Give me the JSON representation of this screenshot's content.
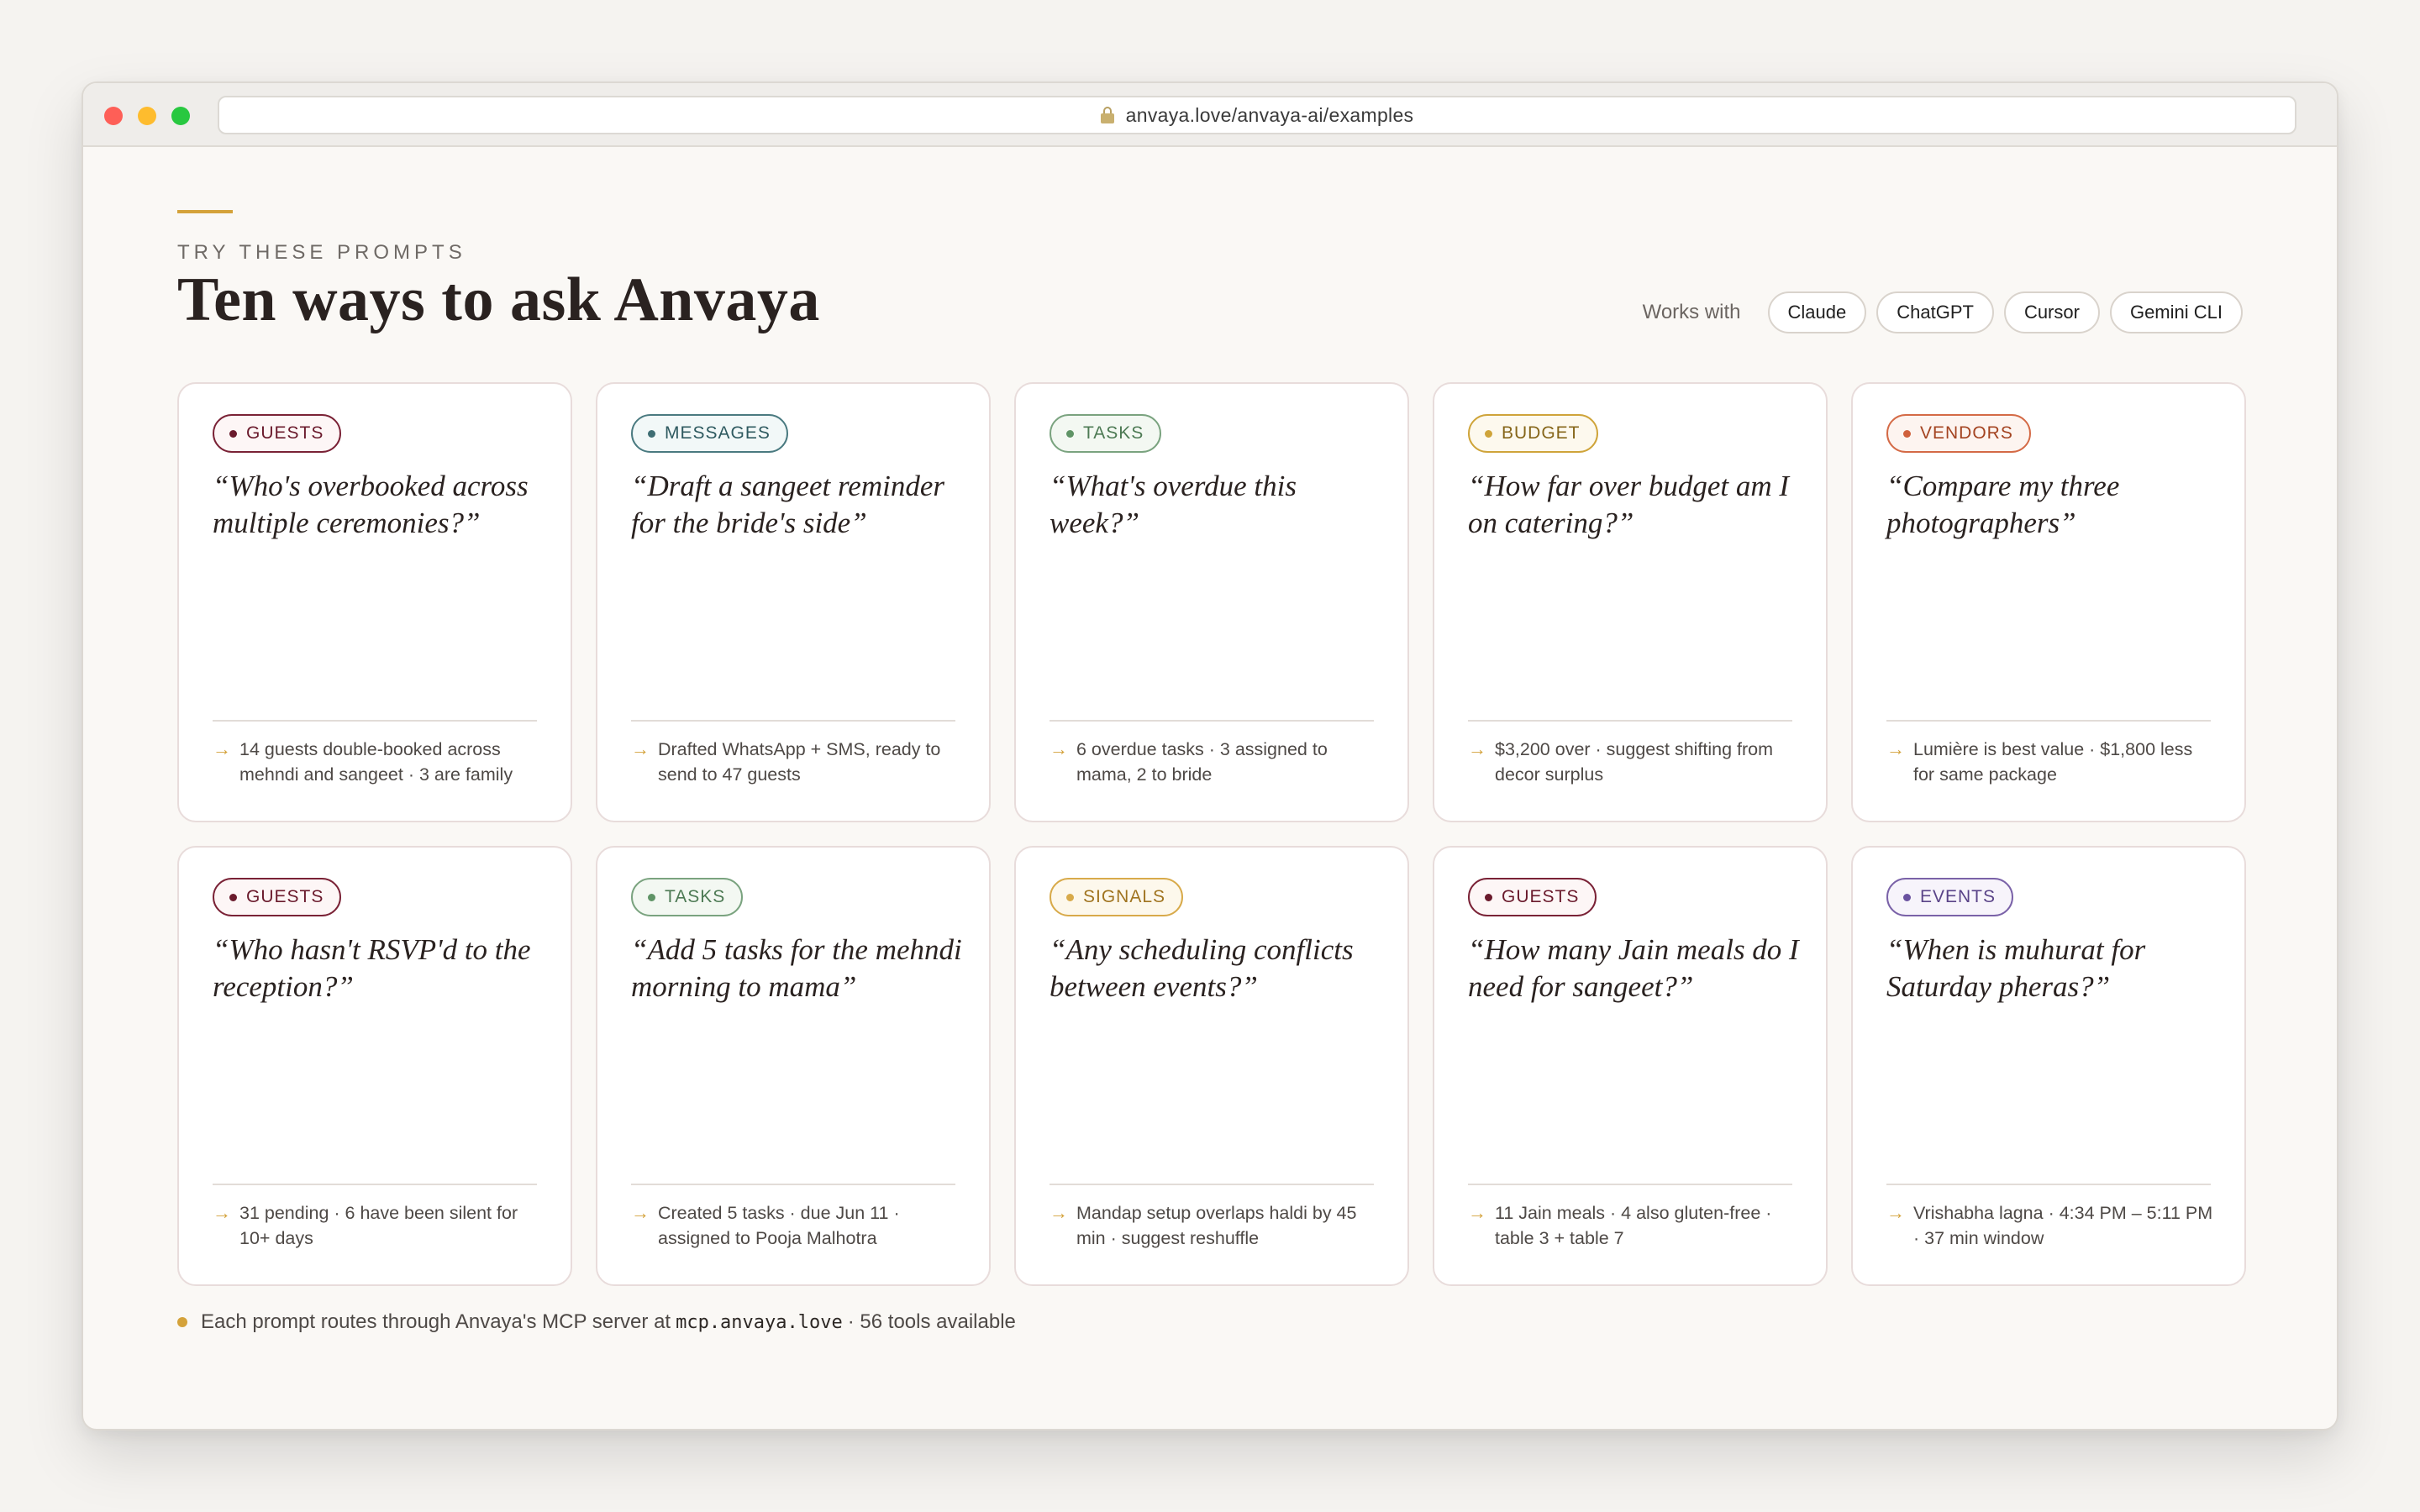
{
  "browser": {
    "url": "anvaya.love/anvaya-ai/examples"
  },
  "header": {
    "eyebrow": "TRY THESE PROMPTS",
    "title": "Ten ways to ask Anvaya",
    "works_with_label": "Works with",
    "tools": [
      "Claude",
      "ChatGPT",
      "Cursor",
      "Gemini CLI"
    ]
  },
  "cards": [
    {
      "tag": "GUESTS",
      "tag_style": "guests",
      "prompt": "“Who's overbooked across multiple ceremonies?”",
      "result": "14 guests double-booked across mehndi and sangeet · 3 are family"
    },
    {
      "tag": "MESSAGES",
      "tag_style": "messages",
      "prompt": "“Draft a sangeet reminder for the bride's side”",
      "result": "Drafted WhatsApp + SMS, ready to send to 47 guests"
    },
    {
      "tag": "TASKS",
      "tag_style": "tasks",
      "prompt": "“What's overdue this week?”",
      "result": "6 overdue tasks · 3 assigned to mama, 2 to bride"
    },
    {
      "tag": "BUDGET",
      "tag_style": "budget",
      "prompt": "“How far over budget am I on catering?”",
      "result": "$3,200 over · suggest shifting from decor surplus"
    },
    {
      "tag": "VENDORS",
      "tag_style": "vendors",
      "prompt": "“Compare my three photographers”",
      "result": "Lumière is best value · $1,800 less for same package"
    },
    {
      "tag": "GUESTS",
      "tag_style": "guests",
      "prompt": "“Who hasn't RSVP'd to the reception?”",
      "result": "31 pending · 6 have been silent for 10+ days"
    },
    {
      "tag": "TASKS",
      "tag_style": "tasks",
      "prompt": "“Add 5 tasks for the mehndi morning to mama”",
      "result": "Created 5 tasks · due Jun 11 · assigned to Pooja Malhotra"
    },
    {
      "tag": "SIGNALS",
      "tag_style": "signals",
      "prompt": "“Any scheduling conflicts between events?”",
      "result": "Mandap setup overlaps haldi by 45 min · suggest reshuffle"
    },
    {
      "tag": "GUESTS",
      "tag_style": "guests",
      "prompt": "“How many Jain meals do I need for sangeet?”",
      "result": "11 Jain meals · 4 also gluten-free · table 3 + table 7"
    },
    {
      "tag": "EVENTS",
      "tag_style": "events",
      "prompt": "“When is muhurat for Saturday pheras?”",
      "result": "Vrishabha lagna · 4:34 PM – 5:11 PM · 37 min window"
    }
  ],
  "footer": {
    "text_before": "Each prompt routes through Anvaya's MCP server at",
    "server": "mcp.anvaya.love",
    "text_after": "· 56 tools available"
  },
  "colors": {
    "accent": "#d4a23a",
    "background": "#faf8f5",
    "text": "#2a2220"
  }
}
